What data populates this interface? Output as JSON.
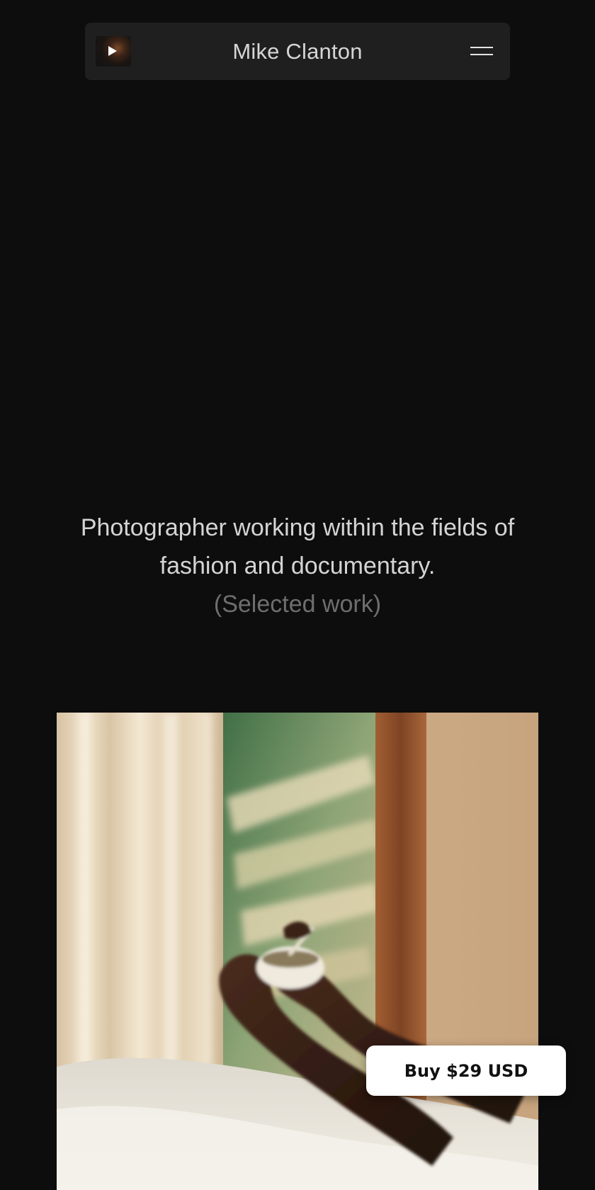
{
  "header": {
    "title": "Mike Clanton",
    "video_thumbnail_icon": "play-icon",
    "menu_icon": "hamburger-menu-icon"
  },
  "intro": {
    "line1": "Photographer working within the fields of",
    "line2": "fashion and documentary.",
    "subtitle": "(Selected work)"
  },
  "cta": {
    "buy_label": "Buy $29 USD"
  },
  "colors": {
    "background": "#0d0d0e",
    "nav_background": "#1f1f20",
    "text_primary": "#d4d4d4",
    "text_muted": "#6e6e6e",
    "button_background": "#ffffff"
  }
}
